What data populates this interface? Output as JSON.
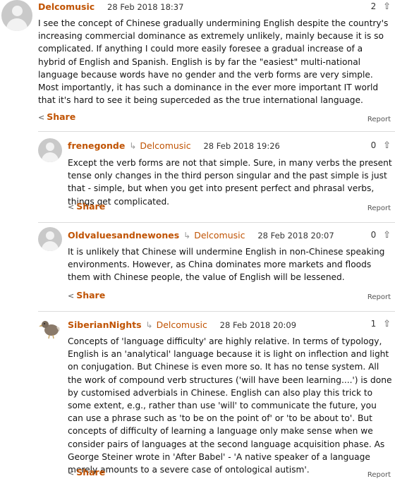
{
  "comments": [
    {
      "username": "Delcomusic",
      "reply_to": "",
      "date": "28 Feb 2018 18:37",
      "votes": "2",
      "upvote_icon": "arrow-up-icon",
      "text": "I see the concept of Chinese gradually undermining English despite the country's increasing commercial dominance as extremely unlikely, mainly because it is so complicated. If anything I could more easily foresee a gradual increase of a hybrid of English and Spanish. English is by far the \"easiest\" multi-national language because words have no gender and the verb forms are very simple. Most importantly, it has such a dominance in the ever more important IT world that it's hard to see it being superceded as the true international language.",
      "share_label": "Share",
      "report_label": "Report"
    },
    {
      "username": "frenegonde",
      "reply_to": "Delcomusic",
      "date": "28 Feb 2018 19:26",
      "votes": "0",
      "text": "Except the verb forms are not that simple. Sure, in many verbs the present tense only changes in the third person singular and the past simple is just that - simple, but when you get into present perfect and phrasal verbs, things get complicated.",
      "share_label": "Share",
      "report_label": "Report"
    },
    {
      "username": "Oldvaluesandnewones",
      "reply_to": "Delcomusic",
      "date": "28 Feb 2018 20:07",
      "votes": "0",
      "text": "It is unlikely that Chinese will undermine English in non-Chinese speaking environments. However, as China dominates more markets and floods them with Chinese people, the value of English will be lessened.",
      "share_label": "Share",
      "report_label": "Report"
    },
    {
      "username": "SiberianNights",
      "reply_to": "Delcomusic",
      "date": "28 Feb 2018 20:09",
      "votes": "1",
      "text": "Concepts of 'language difficulty' are highly relative. In terms of typology, English is an 'analytical' language because it is light on inflection and light on conjugation. But Chinese is even more so. It has no tense system. All the work of compound verb structures ('will have been learning....') is done by customised adverbials in Chinese. English can also play this trick to some extent, e.g., rather than use 'will' to communicate the future, you can use a phrase such as 'to be on the point of' or 'to be about to'. But concepts of difficulty of learning a language only make sense when we consider pairs of languages at the second language acquisition phase. As George Steiner wrote in 'After Babel' - 'A native speaker of a language merely amounts to a severe case of ontological autism'.",
      "share_label": "Share",
      "report_label": "Report"
    }
  ],
  "colors": {
    "accent": "#c05303",
    "divider": "#dcdcdc",
    "avatar_bg": "#c9c9c9"
  }
}
